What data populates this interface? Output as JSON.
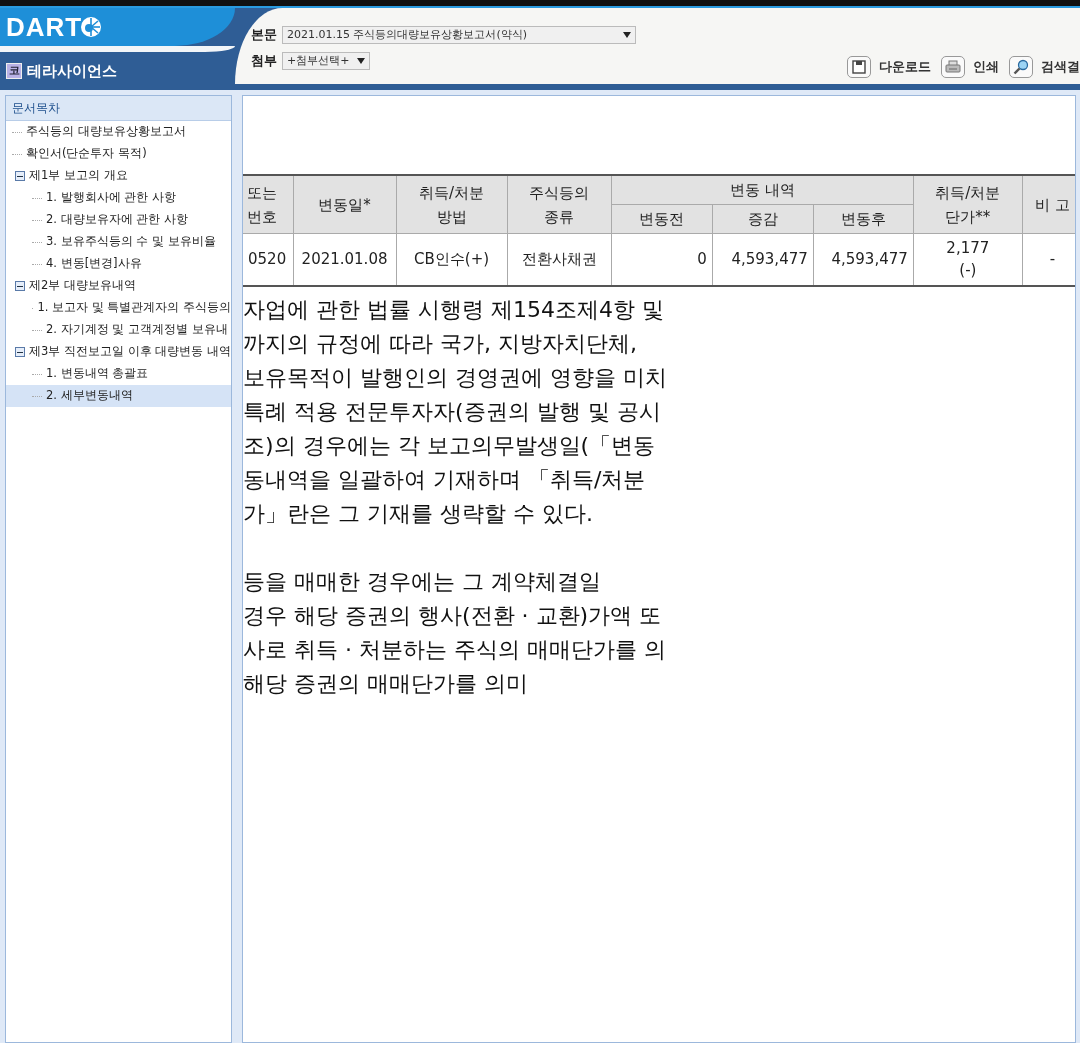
{
  "header": {
    "logo": "DART",
    "company": "테라사이언스",
    "company_badge": "코",
    "main_doc": {
      "label": "본문",
      "value": "2021.01.15 주식등의대량보유상황보고서(약식)"
    },
    "attachment": {
      "label": "첨부",
      "value": "+첨부선택+"
    },
    "toolbar": [
      {
        "kind": "download",
        "label": "다운로드"
      },
      {
        "kind": "print",
        "label": "인쇄"
      },
      {
        "kind": "search",
        "label": "검색결"
      }
    ]
  },
  "sidebar": {
    "title": "문서목차",
    "items": [
      {
        "label": "주식등의 대량보유상황보고서",
        "selected": false
      },
      {
        "label": "확인서(단순투자 목적)",
        "selected": false
      },
      {
        "label": "제1부 보고의 개요",
        "selected": false,
        "expanded": true,
        "children": [
          {
            "label": "1. 발행회사에 관한 사항",
            "selected": false
          },
          {
            "label": "2. 대량보유자에 관한 사항",
            "selected": false
          },
          {
            "label": "3. 보유주식등의 수 및 보유비율",
            "selected": false
          },
          {
            "label": "4. 변동[변경]사유",
            "selected": false
          }
        ]
      },
      {
        "label": "제2부 대량보유내역",
        "selected": false,
        "expanded": true,
        "children": [
          {
            "label": "1. 보고자 및 특별관계자의 주식등의",
            "selected": false
          },
          {
            "label": "2. 자기계정 및 고객계정별 보유내",
            "selected": false
          }
        ]
      },
      {
        "label": "제3부 직전보고일 이후 대량변동 내역",
        "selected": false,
        "expanded": true,
        "children": [
          {
            "label": "1. 변동내역 총괄표",
            "selected": false
          },
          {
            "label": "2. 세부변동내역",
            "selected": true
          }
        ]
      }
    ]
  },
  "table": {
    "header_rows": [
      [
        {
          "text": "또는\n번호",
          "rowspan": 2
        },
        {
          "text": "변동일*",
          "rowspan": 2
        },
        {
          "text": "취득/처분\n방법",
          "rowspan": 2
        },
        {
          "text": "주식등의\n종류",
          "rowspan": 2
        },
        {
          "text": "변동 내역",
          "colspan": 3
        },
        {
          "text": "취득/처분\n단가**",
          "rowspan": 2
        },
        {
          "text": "비 고",
          "rowspan": 2
        }
      ],
      [
        {
          "text": "변동전"
        },
        {
          "text": "증감"
        },
        {
          "text": "변동후"
        }
      ]
    ],
    "rows": [
      [
        "0520",
        "2021.01.08",
        "CB인수(+)",
        "전환사채권",
        "0",
        "4,593,477",
        "4,593,477",
        "2,177\n(-)",
        "-"
      ]
    ]
  },
  "notes": [
    [
      "자업에 관한 법률 시행령 제154조제4항 및",
      "까지의 규정에 따라 국가, 지방자치단체,",
      "보유목적이 발행인의 경영권에 영향을 미치",
      "특례 적용 전문투자자(증권의 발행 및 공시",
      "조)의 경우에는 각 보고의무발생일(「변동",
      "동내역을 일괄하여 기재하며 「취득/처분",
      "가」란은 그 기재를 생략할 수 있다."
    ],
    [
      "등을 매매한 경우에는 그 계약체결일",
      "경우 해당 증권의 행사(전환 · 교환)가액 또",
      "사로 취득 · 처분하는 주식의 매매단가를 의",
      "해당 증권의 매매단가를 의미"
    ]
  ]
}
